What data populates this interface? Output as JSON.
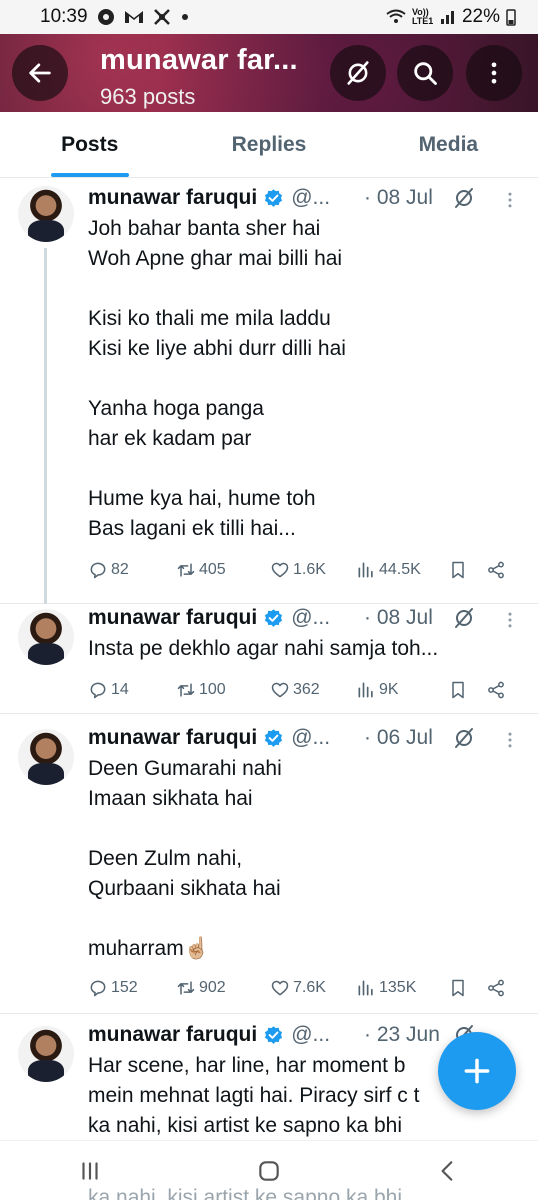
{
  "status": {
    "time": "10:39",
    "network_label": "Vo)) LTE1",
    "battery": "22%"
  },
  "header": {
    "title": "munawar far...",
    "post_count": "963 posts"
  },
  "tabs": [
    {
      "label": "Posts",
      "active": true
    },
    {
      "label": "Replies",
      "active": false
    },
    {
      "label": "Media",
      "active": false
    }
  ],
  "tweets": [
    {
      "name": "munawar faruqui",
      "handle": "@...",
      "date": "· 08 Jul",
      "text": "Joh bahar banta sher hai\nWoh Apne ghar mai billi hai\n\nKisi ko thali me mila laddu\nKisi ke liye abhi durr dilli hai\n\nYanha hoga panga\nhar ek kadam par\n\nHume kya hai, hume toh\nBas lagani ek tilli hai...",
      "replies": "82",
      "reposts": "405",
      "likes": "1.6K",
      "views": "44.5K"
    },
    {
      "name": "munawar faruqui",
      "handle": "@...",
      "date": "· 08 Jul",
      "text": "Insta pe dekhlo agar nahi samja toh...",
      "replies": "14",
      "reposts": "100",
      "likes": "362",
      "views": "9K"
    },
    {
      "name": "munawar faruqui",
      "handle": "@...",
      "date": "· 06 Jul",
      "text": "Deen Gumarahi nahi\nImaan sikhata hai\n\nDeen Zulm nahi,\nQurbaani sikhata hai\n\nmuharram☝🏼",
      "replies": "152",
      "reposts": "902",
      "likes": "7.6K",
      "views": "135K"
    },
    {
      "name": "munawar faruqui",
      "handle": "@...",
      "date": "· 23 Jun",
      "text": "Har scene, har line, har moment b\nmein mehnat lagti hai. Piracy sirf c       t\nka nahi, kisi artist ke sapno ka bhi"
    }
  ],
  "peek_text": "ka nahi, kisi artist ke sapno ka bhi",
  "colors": {
    "accent": "#1d9bf0",
    "secondary_text": "#536471"
  }
}
